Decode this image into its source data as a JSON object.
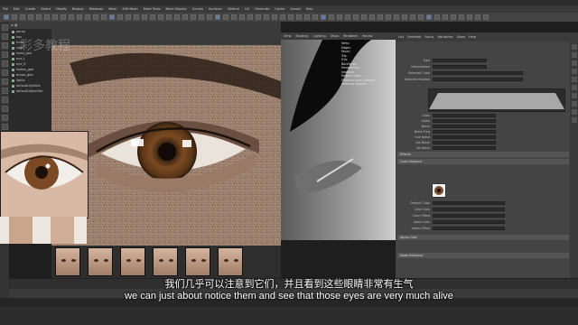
{
  "menu": [
    "File",
    "Edit",
    "Create",
    "Select",
    "Modify",
    "Display",
    "Windows",
    "Mesh",
    "Edit Mesh",
    "Mesh Tools",
    "Mesh Display",
    "Curves",
    "Surfaces",
    "Deform",
    "UV",
    "Generate",
    "Cache",
    "Arnold",
    "Help"
  ],
  "outliner": {
    "items": [
      "persp",
      "top",
      "front",
      "side",
      "head_geo",
      "eye_L",
      "eye_R",
      "lashes_geo",
      "brows_geo",
      "lights",
      "defaultLightSet",
      "defaultObjectSet"
    ]
  },
  "viewport": {
    "menu": [
      "View",
      "Shading",
      "Lighting",
      "Show",
      "Renderer",
      "Panels"
    ],
    "hud": [
      "Verts:",
      "Edges:",
      "Faces:",
      "Tris:",
      "UVs:",
      "Backfaces:",
      "Smoothness:",
      "Instance:",
      "Display Layer:",
      "Distance From Camera:",
      "Selected Objects:"
    ]
  },
  "attr_editor": {
    "tabs": [
      "List",
      "Selected",
      "Focus",
      "Attributes",
      "Show",
      "Help"
    ],
    "rows_top": [
      "Type",
      "Interpolation",
      "Selected Color",
      "Selected Position"
    ],
    "rows_mid": [
      "Color",
      "Alpha",
      "Noise",
      "Noise Freq",
      "Hue Noise",
      "Sat Noise",
      "Val Noise"
    ],
    "sections": [
      "Effects",
      "Color Balance",
      "Alpha Gain",
      "Node Behavior"
    ],
    "rows_low": [
      "Default Color",
      "Color Gain",
      "Color Offset",
      "Alpha Gain",
      "Alpha Offset"
    ]
  },
  "subtitles": {
    "zh": "我们几乎可以注意到它们，并且看到这些眼睛非常有生气",
    "en": "we can just about notice them and see that those eyes are very much alive"
  },
  "watermark": "彩多教程"
}
